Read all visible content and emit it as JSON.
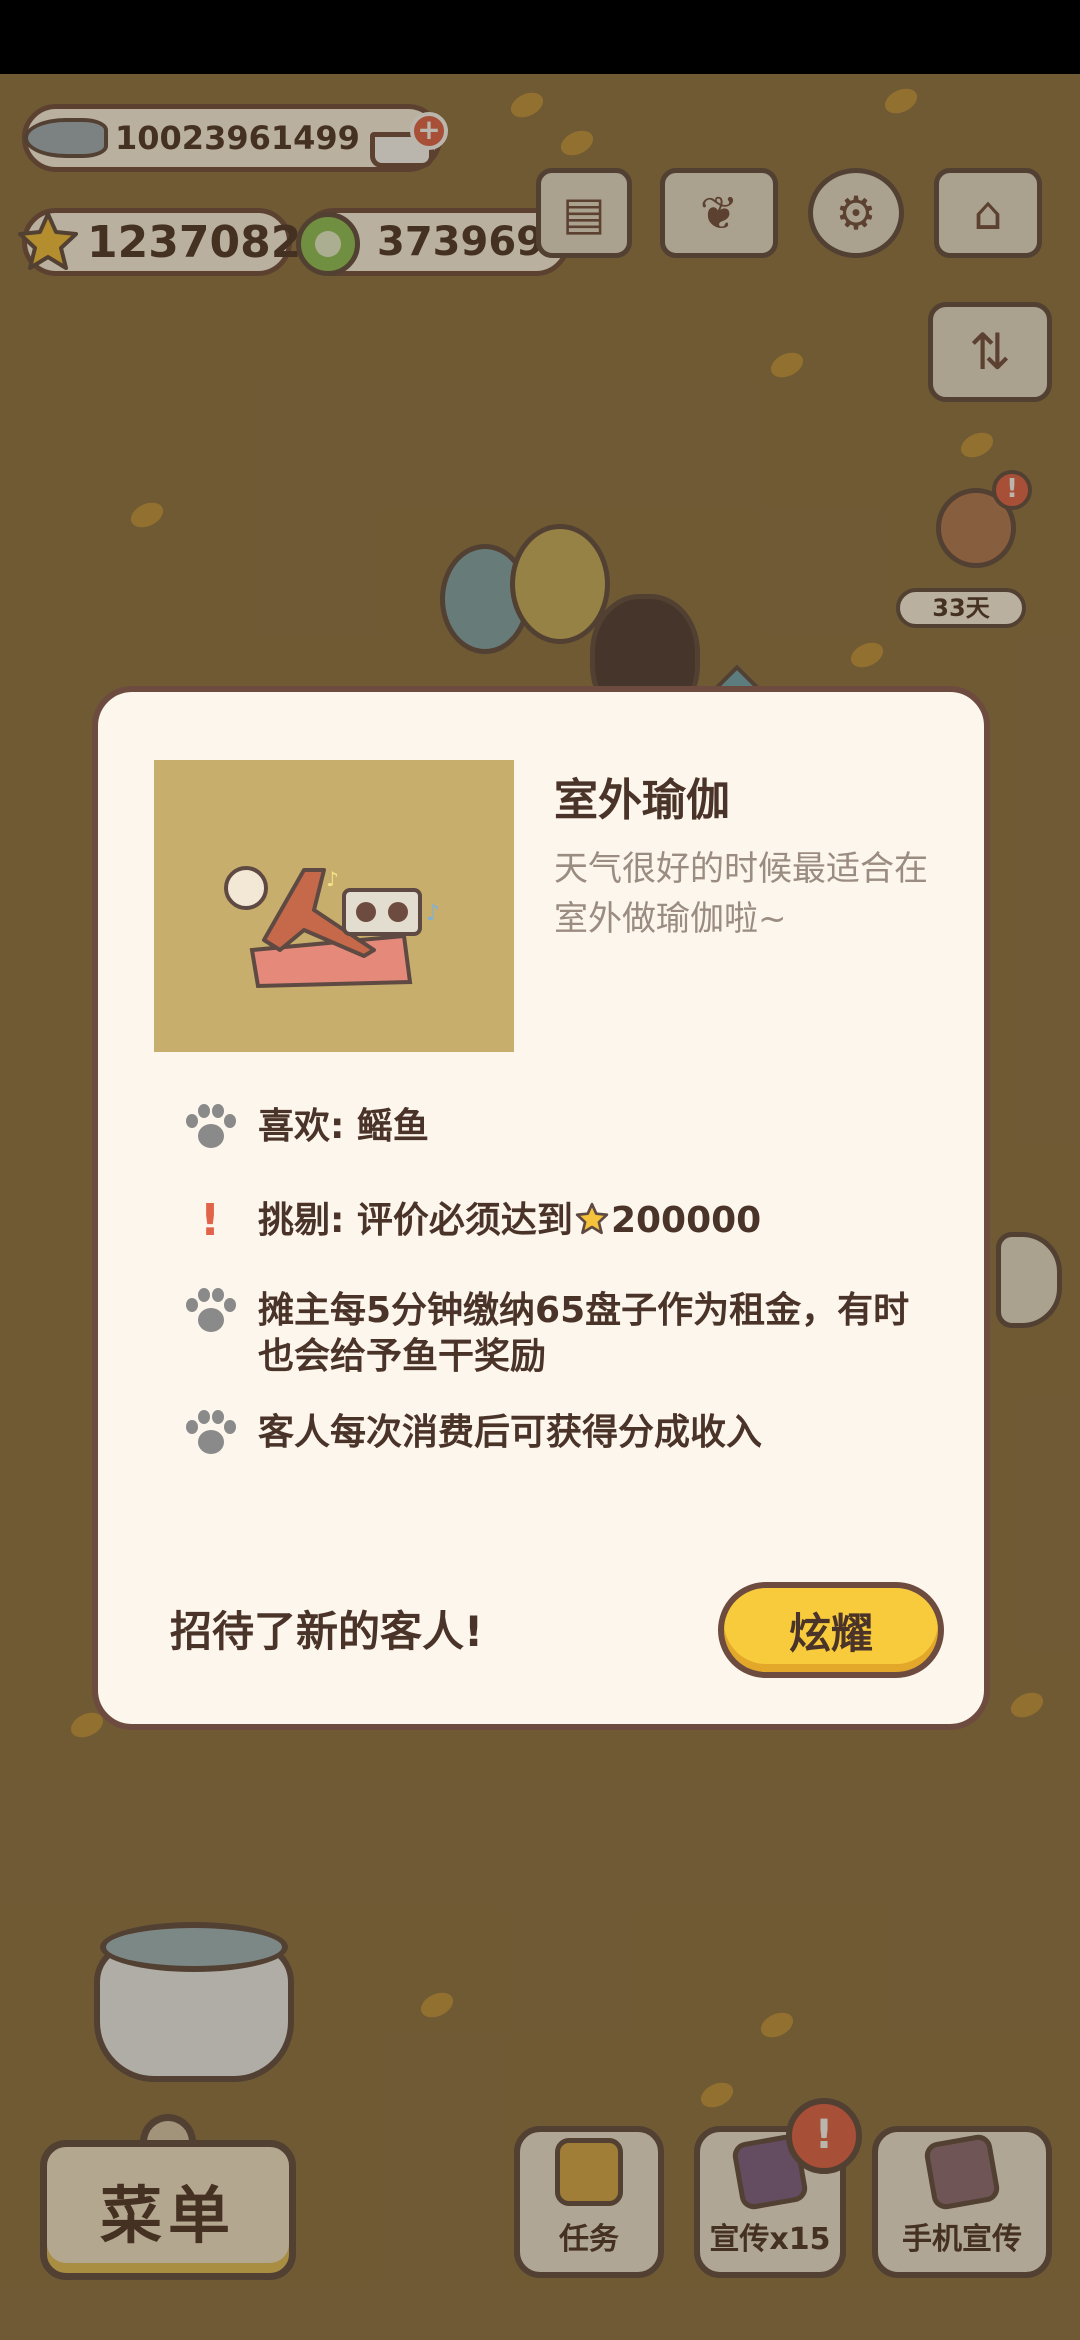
{
  "currency": {
    "fish": "10023961499",
    "stars": "1237082",
    "coins": "373969"
  },
  "event": {
    "days": "33天"
  },
  "dialog": {
    "title": "室外瑜伽",
    "description": "天气很好的时候最适合在室外做瑜伽啦~",
    "likes": "喜欢: 鳐鱼",
    "picky_prefix": "挑剔: 评价必须达到",
    "picky_value": "200000",
    "rent": "摊主每5分钟缴纳65盘子作为租金，有时也会给予鱼干奖励",
    "income": "客人每次消费后可获得分成收入",
    "footer": "招待了新的客人!",
    "show_button": "炫耀"
  },
  "bottom_bar": {
    "menu": "菜单",
    "tasks": "任务",
    "promote": "宣传x15",
    "phone_promote": "手机宣传"
  },
  "colors": {
    "background": "#8a7246",
    "dialog_bg": "#fdf6ec",
    "border": "#6d4c3f",
    "accent_yellow": "#f8cb3c",
    "alert_red": "#e0634a"
  },
  "icons": [
    "fish-icon",
    "cart-icon",
    "star-icon",
    "coin-icon",
    "newspaper-icon",
    "book-icon",
    "gear-icon",
    "shop-icon",
    "sort-icon",
    "paw-icon",
    "exclamation-icon"
  ]
}
